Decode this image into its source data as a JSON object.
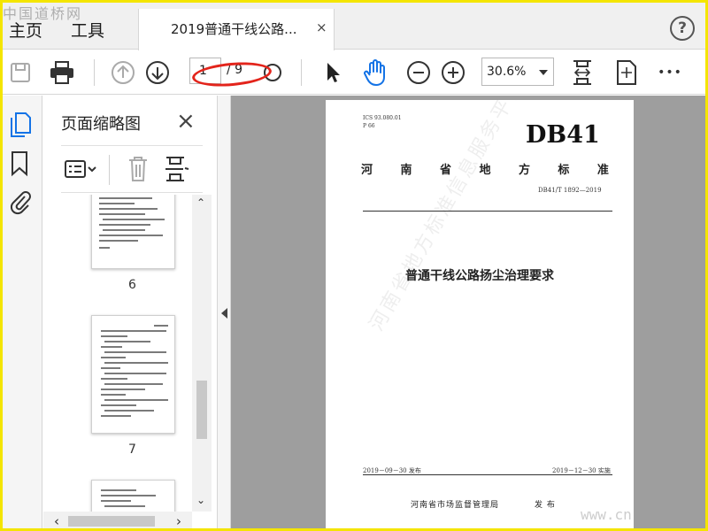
{
  "watermark": {
    "top_left": "中国道桥网",
    "bottom_right": "www.cn"
  },
  "menu": {
    "home": "主页",
    "tools": "工具"
  },
  "tab": {
    "title": "2019普通干线公路...",
    "close": "×"
  },
  "help": {
    "label": "?"
  },
  "toolbar": {
    "page_current": "1",
    "page_total": "/ 9",
    "zoom": "30.6%",
    "more": "•••"
  },
  "panel": {
    "title": "页面缩略图",
    "close": "×"
  },
  "thumbnails": [
    {
      "num": "6"
    },
    {
      "num": "7"
    }
  ],
  "scroll": {
    "up": "⌃",
    "down": "⌄",
    "left": "‹",
    "right": "›"
  },
  "page": {
    "ics": "ICS 93.080.01",
    "p": "P 66",
    "db": "DB41",
    "province": [
      "河",
      "南",
      "省",
      "地",
      "方",
      "标",
      "准"
    ],
    "code": "DB41/T 1892—2019",
    "title": "普通干线公路扬尘治理要求",
    "issue_date": "2019－09－30 发布",
    "impl_date": "2019－12－30 实施",
    "publisher": "河南省市场监督管理局",
    "publish": "发 布",
    "watermark": "河南省地方标准信息服务平台"
  },
  "colors": {
    "accent_blue": "#1473e6",
    "highlight_red": "#e3241b",
    "frame_yellow": "#f4e500"
  }
}
